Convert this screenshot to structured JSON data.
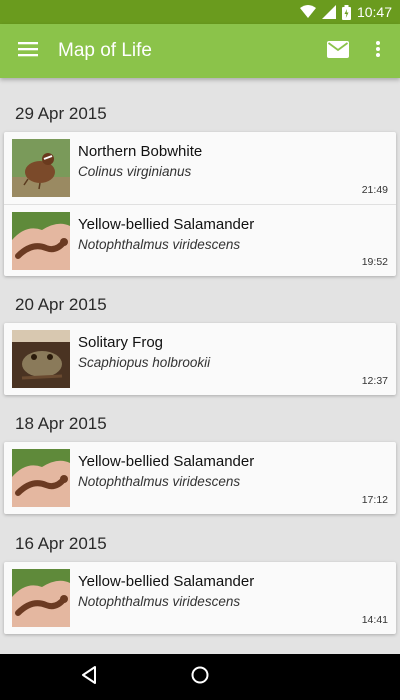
{
  "status_bar": {
    "time": "10:47",
    "icons": [
      "wifi-icon",
      "signal-icon",
      "battery-icon"
    ]
  },
  "app_bar": {
    "title": "Map of Life",
    "icons": [
      "menu-icon",
      "mail-icon",
      "overflow-icon"
    ]
  },
  "colors": {
    "app_bar": "#8bc34a",
    "status_bar": "#6a9b1e",
    "background": "#e3e3e3",
    "card": "#fafafa"
  },
  "groups": [
    {
      "date": "29 Apr 2015",
      "entries": [
        {
          "common_name": "Northern Bobwhite",
          "scientific_name": "Colinus virginianus",
          "time": "21:49",
          "thumb": "bird"
        },
        {
          "common_name": "Yellow-bellied Salamander",
          "scientific_name": "Notophthalmus viridescens",
          "time": "19:52",
          "thumb": "salamander"
        }
      ]
    },
    {
      "date": "20 Apr 2015",
      "entries": [
        {
          "common_name": "Solitary Frog",
          "scientific_name": "Scaphiopus holbrookii",
          "time": "12:37",
          "thumb": "frog"
        }
      ]
    },
    {
      "date": "18 Apr 2015",
      "entries": [
        {
          "common_name": "Yellow-bellied Salamander",
          "scientific_name": "Notophthalmus viridescens",
          "time": "17:12",
          "thumb": "salamander"
        }
      ]
    },
    {
      "date": "16 Apr 2015",
      "entries": [
        {
          "common_name": "Yellow-bellied Salamander",
          "scientific_name": "Notophthalmus viridescens",
          "time": "14:41",
          "thumb": "salamander"
        }
      ]
    }
  ],
  "nav_bar": {
    "icons": [
      "back-icon",
      "home-icon"
    ]
  }
}
